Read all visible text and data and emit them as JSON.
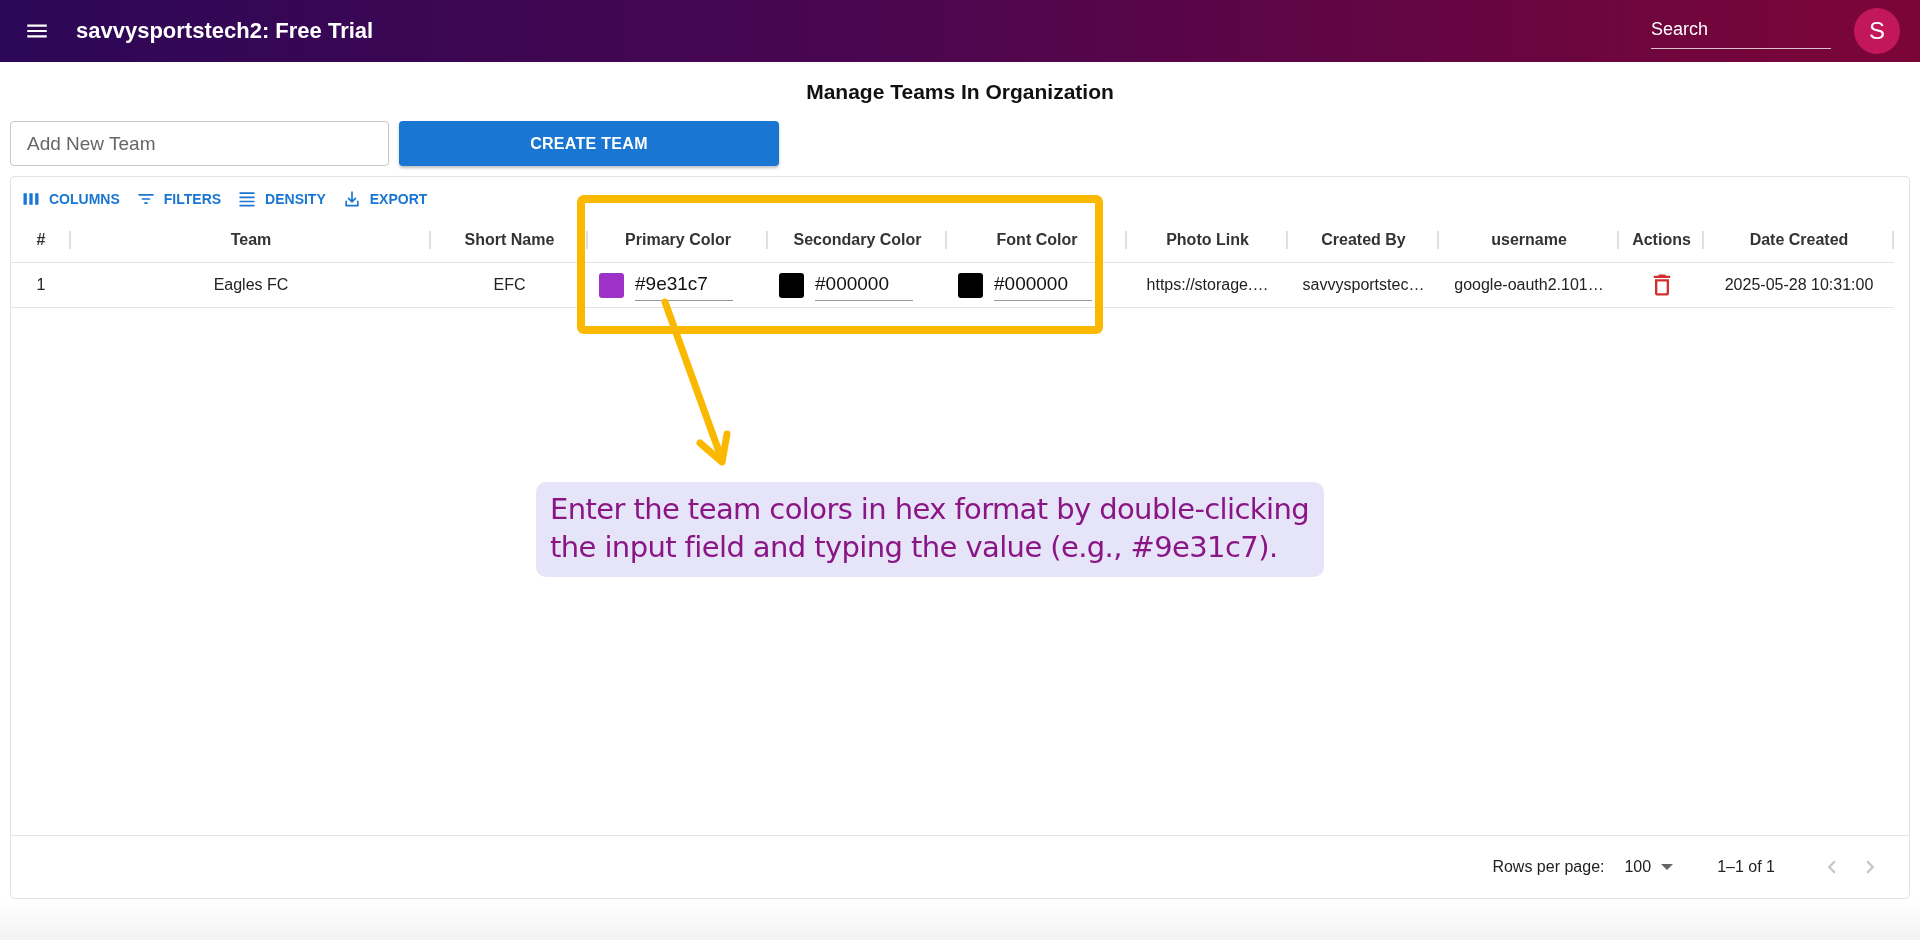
{
  "app_bar": {
    "title": "savvysportstech2: Free Trial",
    "search": {
      "placeholder": "Search"
    },
    "avatar": "S"
  },
  "page_title": "Manage Teams In Organization",
  "new_team": {
    "placeholder": "Add New Team"
  },
  "create_button": "CREATE TEAM",
  "toolbar": [
    {
      "kind": "columns",
      "label": "COLUMNS"
    },
    {
      "kind": "filters",
      "label": "FILTERS"
    },
    {
      "kind": "density",
      "label": "DENSITY"
    },
    {
      "kind": "export",
      "label": "EXPORT"
    }
  ],
  "table": {
    "columns": [
      "#",
      "Team",
      "Short Name",
      "Primary Color",
      "Secondary Color",
      "Font Color",
      "Photo Link",
      "Created By",
      "username",
      "Actions",
      "Date Created"
    ],
    "rows": [
      {
        "cells": [
          {
            "kind": "text",
            "text": "1"
          },
          {
            "kind": "text",
            "text": "Eagles FC"
          },
          {
            "kind": "text",
            "text": "EFC"
          },
          {
            "kind": "color",
            "value": "#9e31c7",
            "color": "#9e31c7"
          },
          {
            "kind": "color",
            "value": "#000000",
            "color": "#000000"
          },
          {
            "kind": "color",
            "value": "#000000",
            "color": "#000000"
          },
          {
            "kind": "text",
            "text": "https://storage.…"
          },
          {
            "kind": "text",
            "text": "savvysportstec…"
          },
          {
            "kind": "text",
            "text": "google-oauth2.101…"
          },
          {
            "kind": "delete"
          },
          {
            "kind": "text",
            "text": "2025-05-28 10:31:00"
          }
        ]
      }
    ]
  },
  "footer": {
    "rows_per_page_label": "Rows per page:",
    "rows_per_page": "100",
    "range": "1–1 of 1",
    "pager": [
      {
        "kind": "prev",
        "disabled": true
      },
      {
        "kind": "next",
        "disabled": true
      }
    ]
  },
  "annotation": {
    "text": "Enter the team colors in hex format by double-clicking the input field and typing the value (e.g., #9e31c7)."
  }
}
